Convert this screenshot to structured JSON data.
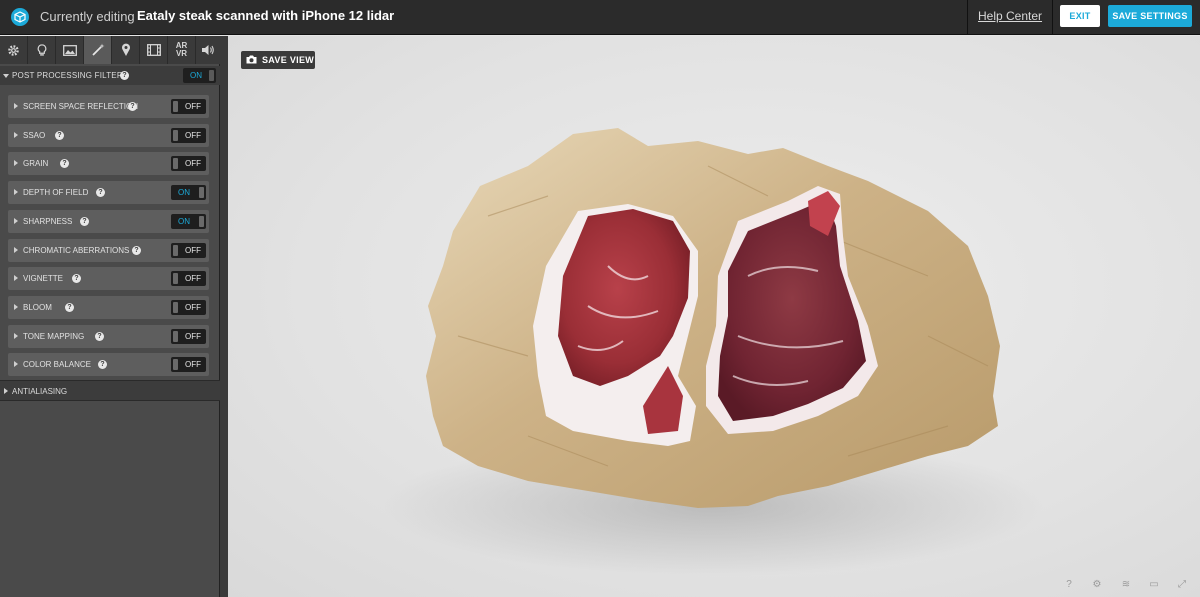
{
  "header": {
    "editing_label": "Currently editing",
    "model_title": "Eataly steak scanned with iPhone 12 lidar",
    "help_link": "Help Center",
    "exit_label": "EXIT",
    "save_settings_label": "SAVE SETTINGS",
    "accent_color": "#1caad9"
  },
  "tabs": [
    {
      "name": "scene",
      "icon": "gear-icon"
    },
    {
      "name": "lights",
      "icon": "lightbulb-icon"
    },
    {
      "name": "environment",
      "icon": "image-icon"
    },
    {
      "name": "post-processing",
      "icon": "magic-wand-icon",
      "active": true
    },
    {
      "name": "annotations",
      "icon": "map-pin-icon"
    },
    {
      "name": "animation",
      "icon": "film-icon"
    },
    {
      "name": "ar-vr",
      "icon": "ar-vr-icon",
      "text_line1": "AR",
      "text_line2": "VR"
    },
    {
      "name": "sound",
      "icon": "speaker-icon"
    }
  ],
  "post_processing": {
    "label": "POST PROCESSING FILTERS",
    "state": "ON",
    "filters": [
      {
        "label": "SCREEN SPACE REFLECTION",
        "state": "OFF"
      },
      {
        "label": "SSAO",
        "state": "OFF"
      },
      {
        "label": "GRAIN",
        "state": "OFF"
      },
      {
        "label": "DEPTH OF FIELD",
        "state": "ON"
      },
      {
        "label": "SHARPNESS",
        "state": "ON"
      },
      {
        "label": "CHROMATIC ABERRATIONS",
        "state": "OFF"
      },
      {
        "label": "VIGNETTE",
        "state": "OFF"
      },
      {
        "label": "BLOOM",
        "state": "OFF"
      },
      {
        "label": "TONE MAPPING",
        "state": "OFF"
      },
      {
        "label": "COLOR BALANCE",
        "state": "OFF"
      }
    ]
  },
  "antialiasing": {
    "label": "ANTIALIASING"
  },
  "viewer": {
    "save_view_label": "SAVE VIEW",
    "controls": [
      {
        "name": "help",
        "icon": "question-icon",
        "glyph": "?"
      },
      {
        "name": "settings",
        "icon": "gear-icon",
        "glyph": "⚙"
      },
      {
        "name": "layers",
        "icon": "layers-icon",
        "glyph": "≋"
      },
      {
        "name": "vr",
        "icon": "vr-headset-icon",
        "glyph": "▭"
      },
      {
        "name": "fullscreen",
        "icon": "fullscreen-icon",
        "glyph": "⤢"
      }
    ]
  }
}
